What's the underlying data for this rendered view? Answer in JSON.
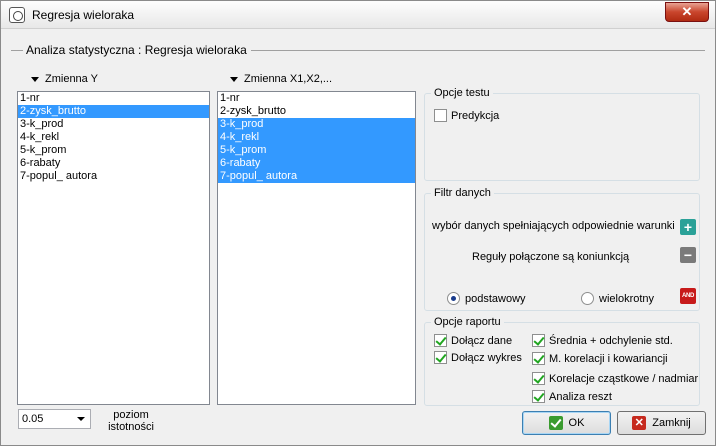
{
  "window": {
    "title": "Regresja wieloraka",
    "close_glyph": "✕"
  },
  "section": {
    "title": "Analiza statystyczna : Regresja wieloraka"
  },
  "list_y": {
    "header": "Zmienna Y",
    "items": [
      "1-nr",
      "2-zysk_brutto",
      "3-k_prod",
      "4-k_rekl",
      "5-k_prom",
      "6-rabaty",
      "7-popul_ autora"
    ],
    "selected": [
      1
    ]
  },
  "list_x": {
    "header": "Zmienna X1,X2,...",
    "items": [
      "1-nr",
      "2-zysk_brutto",
      "3-k_prod",
      "4-k_rekl",
      "5-k_prom",
      "6-rabaty",
      "7-popul_ autora"
    ],
    "selected": [
      2,
      3,
      4,
      5,
      6
    ]
  },
  "test_options": {
    "legend": "Opcje testu",
    "prediction_label": "Predykcja",
    "prediction_checked": false
  },
  "filter": {
    "legend": "Filtr danych",
    "select_label": "wybór danych spełniających odpowiednie warunki",
    "rules_label": "Reguły połączone są koniunkcją",
    "radio_basic": "podstawowy",
    "radio_multiple": "wielokrotny",
    "radio_selected": "podstawowy",
    "and_icon_text": "AND"
  },
  "report": {
    "legend": "Opcje raportu",
    "attach_data": "Dołącz dane",
    "attach_chart": "Dołącz wykres",
    "mean_sd": "Średnia + odchylenie std.",
    "corr_cov": "M. korelacji i kowariancji",
    "partial_corr": "Korelacje cząstkowe / nadmiar",
    "residuals": "Analiza reszt"
  },
  "significance": {
    "value": "0.05",
    "label_line1": "poziom",
    "label_line2": "istotności"
  },
  "buttons": {
    "ok": "OK",
    "close": "Zamknij",
    "close_glyph": "✕"
  },
  "colors": {
    "selection": "#3399ff",
    "close_red": "#c9452c"
  }
}
